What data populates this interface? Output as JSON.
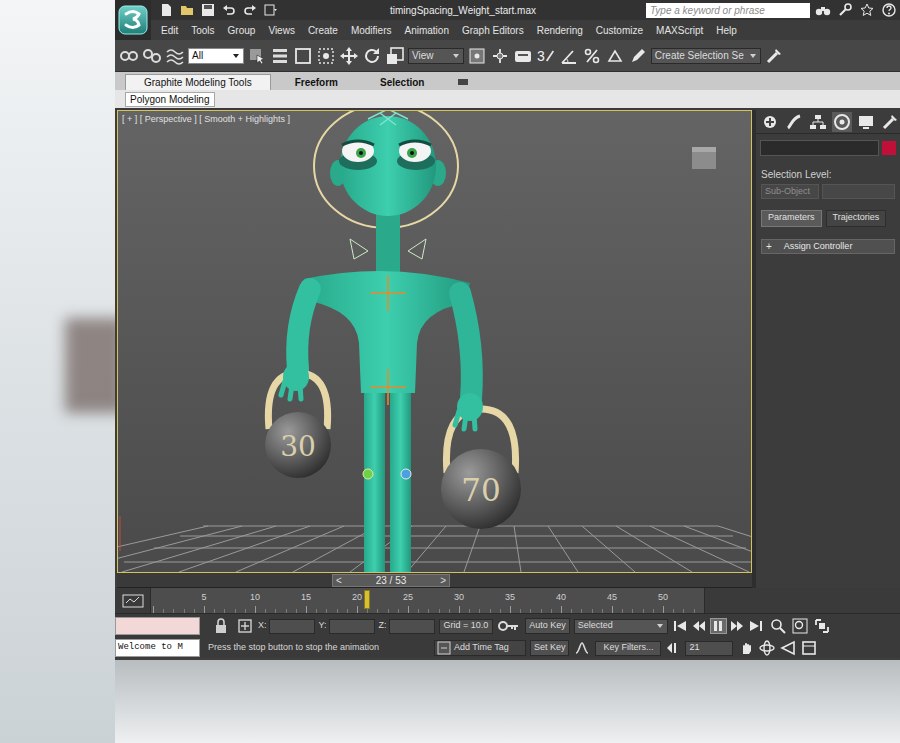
{
  "window": {
    "title": "timingSpacing_Weight_start.max"
  },
  "search": {
    "placeholder": "Type a keyword or phrase"
  },
  "menu": [
    "Edit",
    "Tools",
    "Group",
    "Views",
    "Create",
    "Modifiers",
    "Animation",
    "Graph Editors",
    "Rendering",
    "Customize",
    "MAXScript",
    "Help"
  ],
  "toolbar": {
    "selection_filter": "All",
    "reference_coordinate": "View",
    "snap_toggle": "3",
    "selection_set": "Create Selection Se"
  },
  "ribbon": {
    "tabs": [
      {
        "label": "Graphite Modeling Tools",
        "selected": true
      },
      {
        "label": "Freeform",
        "selected": false
      },
      {
        "label": "Selection",
        "selected": false
      }
    ],
    "panel": "Polygon Modeling"
  },
  "viewport": {
    "label": "[ + ] [ Perspective ] [ Smooth + Highlights ]",
    "active": true,
    "kettlebells": [
      {
        "weight": "30"
      },
      {
        "weight": "70"
      }
    ]
  },
  "command_panel": {
    "selection_level": "Selection Level:",
    "sub_object": "Sub-Object",
    "tabs": [
      {
        "label": "Parameters",
        "selected": true
      },
      {
        "label": "Trajectories",
        "selected": false
      }
    ],
    "rollout": {
      "toggle": "+",
      "label": "Assign Controller"
    }
  },
  "time_slider": {
    "prev": "<",
    "label": "23 / 53",
    "next": ">",
    "level": 0.415
  },
  "track_bar": {
    "ticks": [
      "5",
      "10",
      "15",
      "20",
      "25",
      "30",
      "35",
      "40",
      "45",
      "50"
    ],
    "level": 0.396
  },
  "status": {
    "listener_output": "Welcome to M",
    "prompt": "Press the stop button to stop the animation",
    "axes": [
      "X:",
      "Y:",
      "Z:"
    ],
    "grid": "Grid = 10.0",
    "auto_key": "Auto Key",
    "key_mode": "Selected",
    "set_key": "Set Key",
    "key_filters": "Key Filters...",
    "add_time_tag": "Add Time Tag",
    "current_frame": "21"
  }
}
